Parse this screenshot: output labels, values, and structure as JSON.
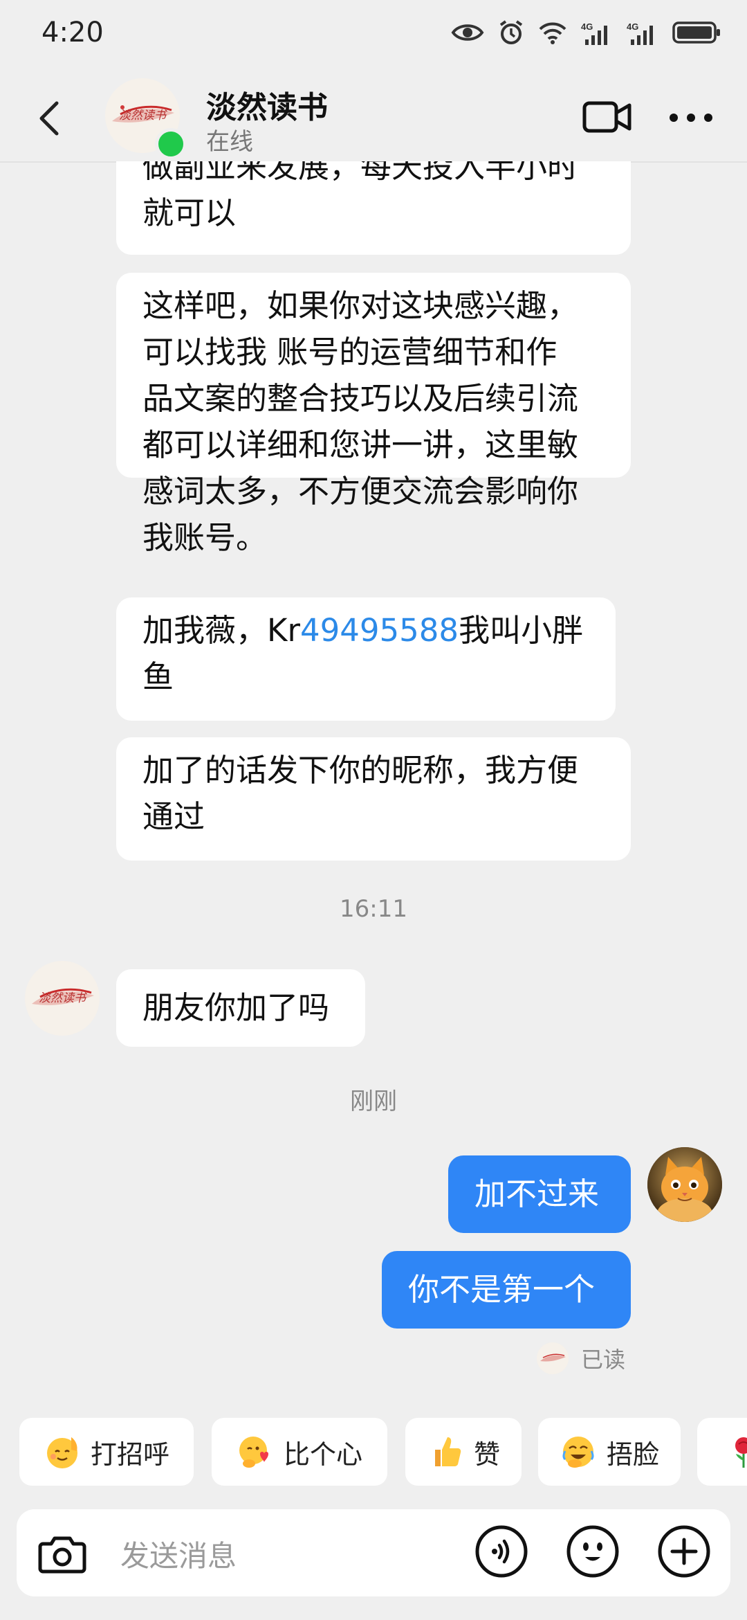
{
  "status_bar": {
    "time": "4:20"
  },
  "header": {
    "title": "淡然读书",
    "subtitle": "在线",
    "avatar_text": "淡然读书"
  },
  "messages": {
    "m0": {
      "line1": "做副业来发展，每天投入半小时",
      "line2": "就可以"
    },
    "m1": {
      "line1": "这样吧，如果你对这块感兴趣，",
      "line2": "可以找我 账号的运营细节和作",
      "line3": "品文案的整合技巧以及后续引流",
      "line4": "都可以详细和您讲一讲，这里敏",
      "line5": "感词太多，不方便交流会影响你",
      "line6": "我账号。"
    },
    "m2": {
      "prefix": "加我薇，Kr",
      "link": "49495588",
      "suffix": "我叫小胖",
      "line2": "鱼"
    },
    "m3": {
      "line1": "加了的话发下你的昵称，我方便",
      "line2": "通过"
    },
    "time1": "16:11",
    "m4": "朋友你加了吗",
    "time2": "刚刚",
    "m5": "加不过来",
    "m6": "你不是第一个",
    "read": "已读"
  },
  "quick_replies": [
    {
      "label": "打招呼",
      "icon": "wave-emoji-icon"
    },
    {
      "label": "比个心",
      "icon": "heart-hands-emoji-icon"
    },
    {
      "label": "赞",
      "icon": "thumbs-up-emoji-icon"
    },
    {
      "label": "捂脸",
      "icon": "facepalm-emoji-icon"
    },
    {
      "label": "",
      "icon": "rose-emoji-icon"
    }
  ],
  "input": {
    "placeholder": "发送消息"
  },
  "colors": {
    "accent": "#2f86f6",
    "link": "#2c8ae8",
    "online": "#20c94b",
    "background": "#efefef"
  }
}
